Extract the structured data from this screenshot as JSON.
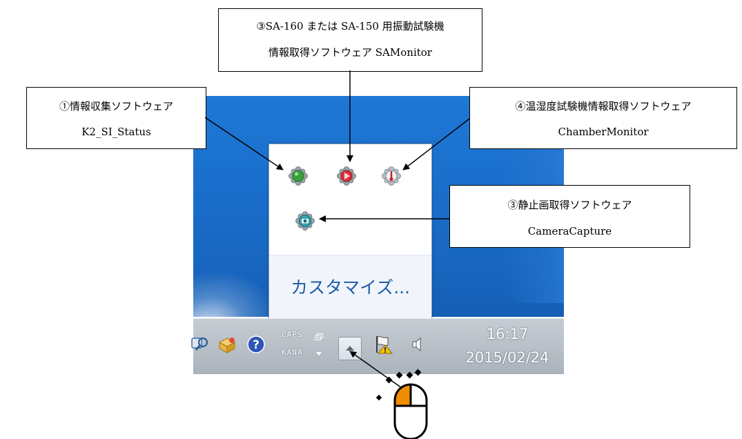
{
  "callouts": {
    "sa_monitor": {
      "line1": "③SA-160 または SA-150 用振動試験機",
      "line2": "情報取得ソフトウェア SAMonitor"
    },
    "k2_status": {
      "line1": "①情報収集ソフトウェア",
      "line2": "K2_SI_Status"
    },
    "chamber_monitor": {
      "line1": "④温湿度試験機情報取得ソフトウェア",
      "line2": "ChamberMonitor"
    },
    "camera_capture": {
      "line1": "③静止画取得ソフトウェア",
      "line2": "CameraCapture"
    }
  },
  "tray_popup": {
    "customize_label": "カスタマイズ...",
    "icons": [
      "k2-si-status-icon",
      "sa-monitor-icon",
      "chamber-monitor-icon",
      "camera-capture-icon"
    ]
  },
  "taskbar": {
    "ime_caps": "CAPS",
    "ime_kana": "KANA",
    "clock_time": "16:17",
    "clock_date": "2015/02/24",
    "icons": [
      "network-search-icon",
      "package-icon",
      "help-icon",
      "ime-icon",
      "show-hidden-icons-button",
      "action-center-flag-icon",
      "volume-icon"
    ]
  },
  "colors": {
    "desktop_blue": "#1a6fcc",
    "taskbar_gray": "#b9c0c8",
    "customize_link": "#1e5aa8",
    "mouse_button_highlight": "#f08c00"
  }
}
